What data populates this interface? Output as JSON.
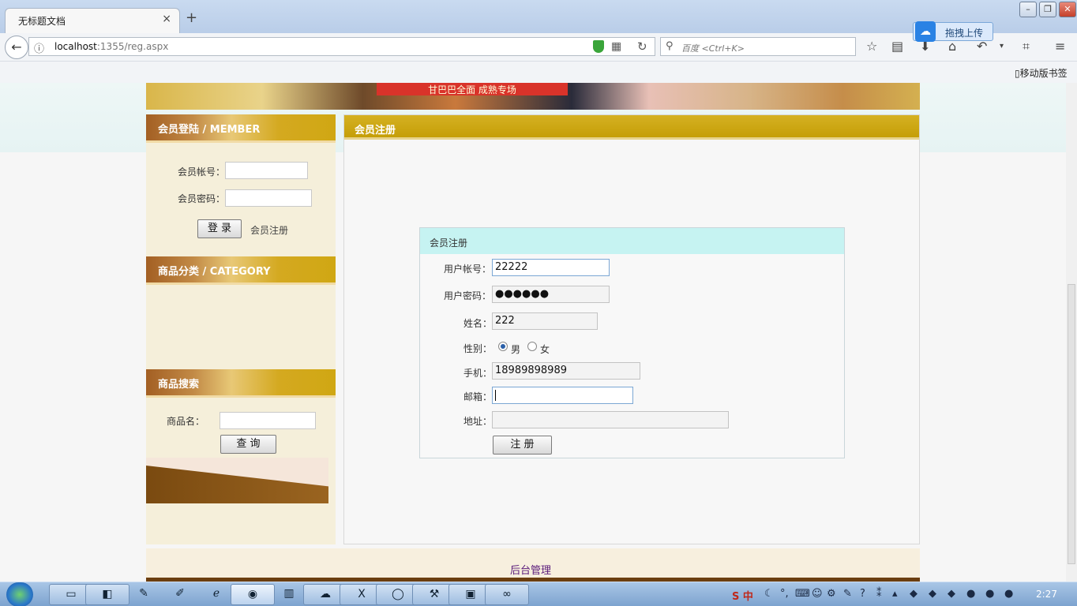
{
  "browser": {
    "tab_title": "无标题文档",
    "tab_close": "×",
    "new_tab": "+",
    "url_host": "localhost",
    "url_rest": ":1355/reg.aspx",
    "search_placeholder": "百度 <Ctrl+K>",
    "upload_label": "拖拽上传",
    "mobile_bookmarks": "移动版书签",
    "window_buttons": [
      "–",
      "❐",
      "✕"
    ]
  },
  "banner": {
    "text": "甘巴巴全面  成熟专场"
  },
  "sidebar": {
    "member_title": "会员登陆 / MEMBER",
    "account_label": "会员帐号：",
    "password_label": "会员密码：",
    "login_button": "登 录",
    "register_link": "会员注册",
    "category_title": "商品分类 / CATEGORY",
    "search_title": "商品搜索",
    "product_name_label": "商品名：",
    "query_button": "查 询"
  },
  "main": {
    "panel_title": "会员注册",
    "form_title": "会员注册",
    "fields": {
      "username_label": "用户帐号：",
      "username_value": "22222",
      "password_label": "用户密码：",
      "password_value": "●●●●●●",
      "name_label": "姓名：",
      "name_value": "222",
      "gender_label": "性别：",
      "gender_male": "男",
      "gender_female": "女",
      "phone_label": "手机：",
      "phone_value": "18989898989",
      "email_label": "邮箱：",
      "email_value": "",
      "address_label": "地址：",
      "address_value": ""
    },
    "submit_button": "注 册"
  },
  "footer": {
    "admin_link": "后台管理"
  },
  "taskbar": {
    "clock": "2:27",
    "tray_ime": "S 中"
  }
}
